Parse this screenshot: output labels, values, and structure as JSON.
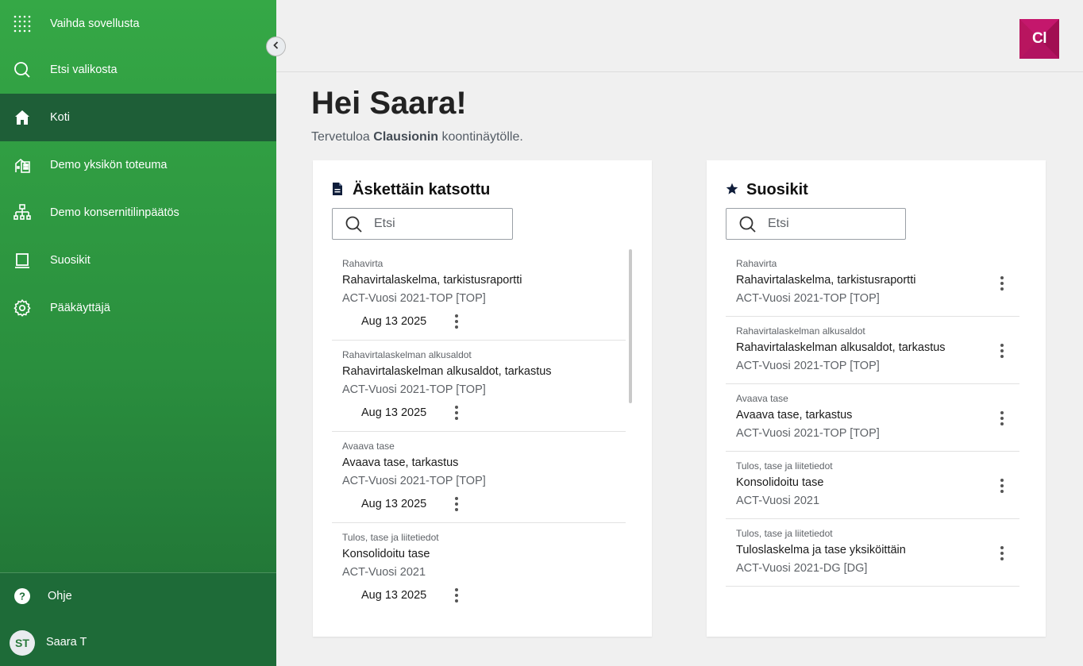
{
  "sidebar": {
    "items": [
      {
        "label": "Vaihda sovellusta",
        "icon": "app-grid-icon"
      },
      {
        "label": "Etsi valikosta",
        "icon": "search-icon"
      },
      {
        "label": "Koti",
        "icon": "home-icon"
      },
      {
        "label": "Demo yksikön toteuma",
        "icon": "building-icon"
      },
      {
        "label": "Demo konsernitilinpäätös",
        "icon": "org-chart-icon"
      },
      {
        "label": "Suosikit",
        "icon": "laptop-icon"
      },
      {
        "label": "Pääkäyttäjä",
        "icon": "gear-icon"
      }
    ],
    "help_label": "Ohje",
    "user": {
      "initials": "ST",
      "name": "Saara T"
    }
  },
  "header": {
    "logo_text": "Cl"
  },
  "main": {
    "greeting": "Hei Saara!",
    "welcome_prefix": "Tervetuloa ",
    "welcome_brand": "Clausionin",
    "welcome_suffix": " koontinäytölle."
  },
  "recent": {
    "title": "Äskettäin katsottu",
    "search_placeholder": "Etsi",
    "items": [
      {
        "category": "Rahavirta",
        "title": "Rahavirtalaskelma, tarkistusraportti",
        "subtitle": "ACT-Vuosi 2021-TOP [TOP]",
        "date": "Aug 13 2025"
      },
      {
        "category": "Rahavirtalaskelman alkusaldot",
        "title": "Rahavirtalaskelman alkusaldot, tarkastus",
        "subtitle": "ACT-Vuosi 2021-TOP [TOP]",
        "date": "Aug 13 2025"
      },
      {
        "category": "Avaava tase",
        "title": "Avaava tase, tarkastus",
        "subtitle": "ACT-Vuosi 2021-TOP [TOP]",
        "date": "Aug 13 2025"
      },
      {
        "category": "Tulos, tase ja liitetiedot",
        "title": "Konsolidoitu tase",
        "subtitle": "ACT-Vuosi 2021",
        "date": "Aug 13 2025"
      }
    ]
  },
  "favorites": {
    "title": "Suosikit",
    "search_placeholder": "Etsi",
    "items": [
      {
        "category": "Rahavirta",
        "title": "Rahavirtalaskelma, tarkistusraportti",
        "subtitle": "ACT-Vuosi 2021-TOP [TOP]"
      },
      {
        "category": "Rahavirtalaskelman alkusaldot",
        "title": "Rahavirtalaskelman alkusaldot, tarkastus",
        "subtitle": "ACT-Vuosi 2021-TOP [TOP]"
      },
      {
        "category": "Avaava tase",
        "title": "Avaava tase, tarkastus",
        "subtitle": "ACT-Vuosi 2021-TOP [TOP]"
      },
      {
        "category": "Tulos, tase ja liitetiedot",
        "title": "Konsolidoitu tase",
        "subtitle": "ACT-Vuosi 2021"
      },
      {
        "category": "Tulos, tase ja liitetiedot",
        "title": "Tuloslaskelma ja tase yksiköittäin",
        "subtitle": "ACT-Vuosi 2021-DG [DG]"
      }
    ]
  }
}
